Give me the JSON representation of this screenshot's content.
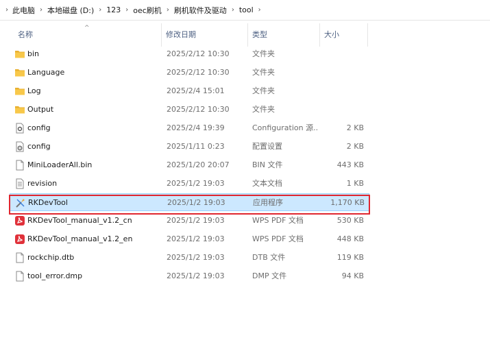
{
  "breadcrumb": [
    "此电脑",
    "本地磁盘 (D:)",
    "123",
    "oec刷机",
    "刷机软件及驱动",
    "tool"
  ],
  "columns": {
    "name": "名称",
    "date": "修改日期",
    "type": "类型",
    "size": "大小"
  },
  "files": [
    {
      "name": "bin",
      "date": "2025/2/12 10:30",
      "type": "文件夹",
      "size": "",
      "icon": "folder-icon"
    },
    {
      "name": "Language",
      "date": "2025/2/12 10:30",
      "type": "文件夹",
      "size": "",
      "icon": "folder-icon"
    },
    {
      "name": "Log",
      "date": "2025/2/4 15:01",
      "type": "文件夹",
      "size": "",
      "icon": "folder-icon"
    },
    {
      "name": "Output",
      "date": "2025/2/12 10:30",
      "type": "文件夹",
      "size": "",
      "icon": "folder-icon"
    },
    {
      "name": "config",
      "date": "2025/2/4 19:39",
      "type": "Configuration 源...",
      "size": "2 KB",
      "icon": "config-file-icon"
    },
    {
      "name": "config",
      "date": "2025/1/11 0:23",
      "type": "配置设置",
      "size": "2 KB",
      "icon": "settings-file-icon"
    },
    {
      "name": "MiniLoaderAll.bin",
      "date": "2025/1/20 20:07",
      "type": "BIN 文件",
      "size": "443 KB",
      "icon": "blank-file-icon"
    },
    {
      "name": "revision",
      "date": "2025/1/2 19:03",
      "type": "文本文档",
      "size": "1 KB",
      "icon": "text-file-icon"
    },
    {
      "name": "RKDevTool",
      "date": "2025/1/2 19:03",
      "type": "应用程序",
      "size": "1,170 KB",
      "icon": "app-icon"
    },
    {
      "name": "RKDevTool_manual_v1.2_cn",
      "date": "2025/1/2 19:03",
      "type": "WPS PDF 文档",
      "size": "530 KB",
      "icon": "pdf-icon"
    },
    {
      "name": "RKDevTool_manual_v1.2_en",
      "date": "2025/1/2 19:03",
      "type": "WPS PDF 文档",
      "size": "448 KB",
      "icon": "pdf-icon"
    },
    {
      "name": "rockchip.dtb",
      "date": "2025/1/2 19:03",
      "type": "DTB 文件",
      "size": "119 KB",
      "icon": "blank-file-icon"
    },
    {
      "name": "tool_error.dmp",
      "date": "2025/1/2 19:03",
      "type": "DMP 文件",
      "size": "94 KB",
      "icon": "blank-file-icon"
    }
  ],
  "selected_index": 8,
  "colors": {
    "selected_bg": "#cce8ff",
    "highlight_border": "#e0262f",
    "folder": "#f8c84a",
    "pdf": "#e0313a"
  }
}
